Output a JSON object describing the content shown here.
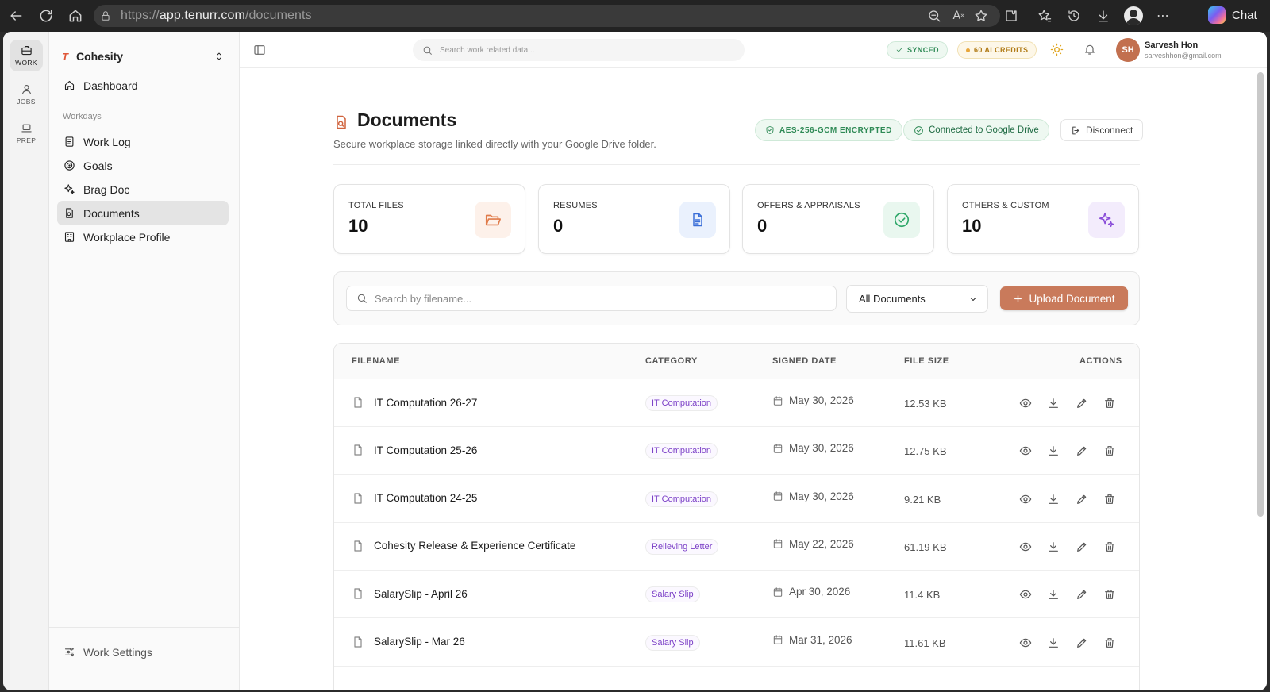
{
  "browser": {
    "url_prefix": "https://",
    "url_host": "app.tenurr.com",
    "url_path": "/documents",
    "chat_label": "Chat"
  },
  "rail": {
    "items": [
      {
        "label": "WORK",
        "icon": "briefcase-icon",
        "active": true
      },
      {
        "label": "JOBS",
        "icon": "user-icon",
        "active": false
      },
      {
        "label": "PREP",
        "icon": "laptop-icon",
        "active": false
      }
    ]
  },
  "sidebar": {
    "org_name": "Cohesity",
    "section_label": "Workdays",
    "items": [
      {
        "label": "Dashboard",
        "icon": "home-icon"
      },
      {
        "label": "Work Log",
        "icon": "log-icon"
      },
      {
        "label": "Goals",
        "icon": "target-icon"
      },
      {
        "label": "Brag Doc",
        "icon": "sparkle-icon"
      },
      {
        "label": "Documents",
        "icon": "documents-icon"
      },
      {
        "label": "Workplace Profile",
        "icon": "building-icon"
      }
    ],
    "footer_label": "Work Settings"
  },
  "topbar": {
    "search_placeholder": "Search work related data...",
    "synced_label": "SYNCED",
    "credits_label": "60 AI CREDITS",
    "user_initials": "SH",
    "user_name": "Sarvesh Hon",
    "user_email": "sarveshhon@gmail.com"
  },
  "page": {
    "title": "Documents",
    "subtitle": "Secure workplace storage linked directly with your Google Drive folder.",
    "encrypted_label": "AES-256-GCM ENCRYPTED",
    "connected_label": "Connected to Google Drive",
    "disconnect_label": "Disconnect"
  },
  "stats": [
    {
      "title": "TOTAL FILES",
      "value": "10",
      "icon": "folder-open-icon",
      "color": "#e07b4a",
      "bg": "#fdf1ea"
    },
    {
      "title": "RESUMES",
      "value": "0",
      "icon": "document-icon",
      "color": "#3b6fd8",
      "bg": "#eaf1fd"
    },
    {
      "title": "OFFERS & APPRAISALS",
      "value": "0",
      "icon": "check-circle-icon",
      "color": "#2fa86a",
      "bg": "#e9f7ef"
    },
    {
      "title": "OTHERS & CUSTOM",
      "value": "10",
      "icon": "sparkle-icon",
      "color": "#8b4fd9",
      "bg": "#f3ecfc"
    }
  ],
  "filters": {
    "search_placeholder": "Search by filename...",
    "select_value": "All Documents",
    "upload_label": "Upload Document"
  },
  "table": {
    "headers": {
      "filename": "FILENAME",
      "category": "CATEGORY",
      "signed_date": "SIGNED DATE",
      "file_size": "FILE SIZE",
      "actions": "ACTIONS"
    },
    "rows": [
      {
        "filename": "IT Computation 26-27",
        "category": "IT Computation",
        "date": "May 30, 2026",
        "size": "12.53 KB"
      },
      {
        "filename": "IT Computation 25-26",
        "category": "IT Computation",
        "date": "May 30, 2026",
        "size": "12.75 KB"
      },
      {
        "filename": "IT Computation 24-25",
        "category": "IT Computation",
        "date": "May 30, 2026",
        "size": "9.21 KB"
      },
      {
        "filename": "Cohesity Release & Experience Certificate",
        "category": "Relieving Letter",
        "date": "May 22, 2026",
        "size": "61.19 KB"
      },
      {
        "filename": "SalarySlip - April 26",
        "category": "Salary Slip",
        "date": "Apr 30, 2026",
        "size": "11.4 KB"
      },
      {
        "filename": "SalarySlip - Mar 26",
        "category": "Salary Slip",
        "date": "Mar 31, 2026",
        "size": "11.61 KB"
      }
    ]
  }
}
